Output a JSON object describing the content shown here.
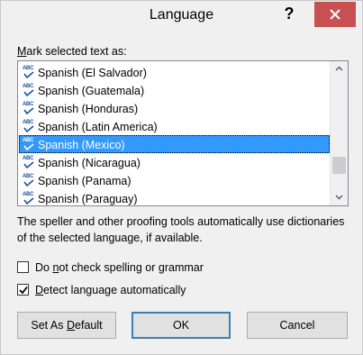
{
  "window": {
    "title": "Language",
    "help_label": "?"
  },
  "mark_label": {
    "underlined": "M",
    "rest": "ark selected text as:"
  },
  "languages": [
    {
      "label": "Spanish (El Salvador)",
      "selected": false
    },
    {
      "label": "Spanish (Guatemala)",
      "selected": false
    },
    {
      "label": "Spanish (Honduras)",
      "selected": false
    },
    {
      "label": "Spanish (Latin America)",
      "selected": false
    },
    {
      "label": "Spanish (Mexico)",
      "selected": true
    },
    {
      "label": "Spanish (Nicaragua)",
      "selected": false
    },
    {
      "label": "Spanish (Panama)",
      "selected": false
    },
    {
      "label": "Spanish (Paraguay)",
      "selected": false
    }
  ],
  "list_icon_text": "ABC",
  "description": "The speller and other proofing tools automatically use dictionaries of the selected language, if available.",
  "options": {
    "no_check": {
      "before": "Do ",
      "underlined": "n",
      "after": "ot check spelling or grammar",
      "checked": false
    },
    "detect": {
      "before": "",
      "underlined": "D",
      "after": "etect language automatically",
      "checked": true
    }
  },
  "buttons": {
    "set_default": {
      "before": "Set As ",
      "underlined": "D",
      "after": "efault"
    },
    "ok": "OK",
    "cancel": "Cancel"
  },
  "colors": {
    "close_button": "#c75050",
    "selection": "#3399ff"
  }
}
